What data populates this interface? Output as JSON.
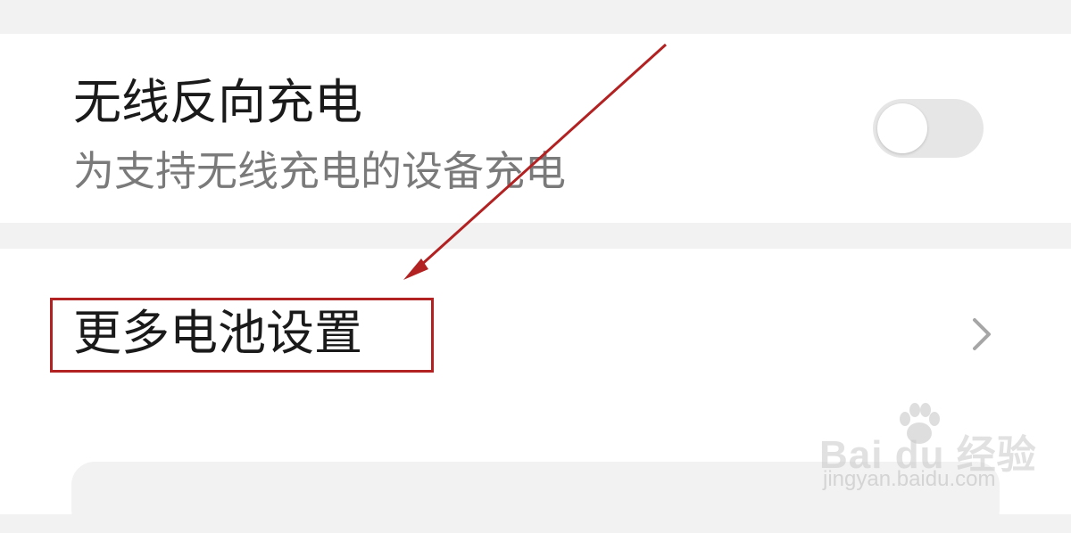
{
  "wireless_reverse_charging": {
    "title": "无线反向充电",
    "subtitle": "为支持无线充电的设备充电",
    "toggle_on": false
  },
  "more_battery_settings": {
    "title": "更多电池设置",
    "chevron_icon": "chevron-right-icon"
  },
  "annotation": {
    "arrow_color": "#b22222",
    "box_color": "#b22222"
  },
  "watermark": {
    "logo": "Bai du 经验",
    "url": "jingyan.baidu.com"
  }
}
